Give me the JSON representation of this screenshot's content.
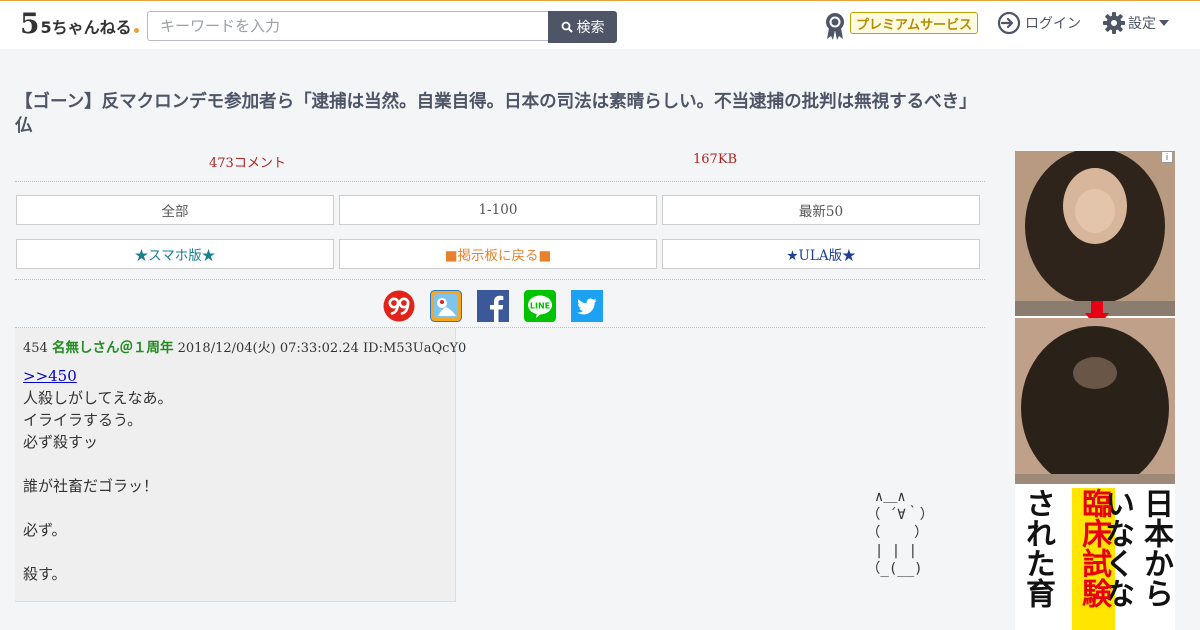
{
  "header": {
    "logo_text": "5ちゃんねる",
    "search_placeholder": "キーワードを入力",
    "search_button": "検索",
    "premium_label": "プレミアムサービス",
    "login_label": "ログイン",
    "settings_label": "設定"
  },
  "thread": {
    "title": "【ゴーン】反マクロンデモ参加者ら「逮捕は当然。自業自得。日本の司法は素晴らしい。不当逮捕の批判は無視するべき」 仏",
    "comment_count": "473コメント",
    "size": "167KB"
  },
  "nav": {
    "row1": [
      "全部",
      "1-100",
      "最新50"
    ],
    "row2": [
      "★スマホ版★",
      "■掲示板に戻る■",
      "★ULA版★"
    ]
  },
  "social": [
    "ninety-nine-icon",
    "rss-reader-icon",
    "facebook-icon",
    "line-icon",
    "twitter-icon"
  ],
  "social_labels": {
    "line": "LINE"
  },
  "post": {
    "number": "454",
    "name": "名無しさん＠１周年",
    "date": "2018/12/04(火) 07:33:02.24",
    "id": "ID:M53UaQcY0",
    "anchor": ">>450",
    "lines": [
      "人殺しがしてえなあ。",
      "イライラするう。",
      "必ず殺すッ",
      "",
      "誰が社畜だゴラッ！",
      "",
      "必ず。",
      "",
      "殺す。"
    ]
  },
  "ascii_art": "  ∧＿∧\n （ ´∀｀）\n （    ）\n  | | |\n （_(__)",
  "ad": {
    "col1": "日本から",
    "col2": "いなくな",
    "col3_highlight": "臨床試験",
    "col4": "された育"
  },
  "colors": {
    "accent": "#e8a33d",
    "count_red": "#b22222",
    "name_green": "#228b22",
    "header_dark": "#4d5566",
    "link_teal": "#1a7f8f",
    "link_orange": "#e8822a",
    "link_navy": "#1c3f95"
  }
}
